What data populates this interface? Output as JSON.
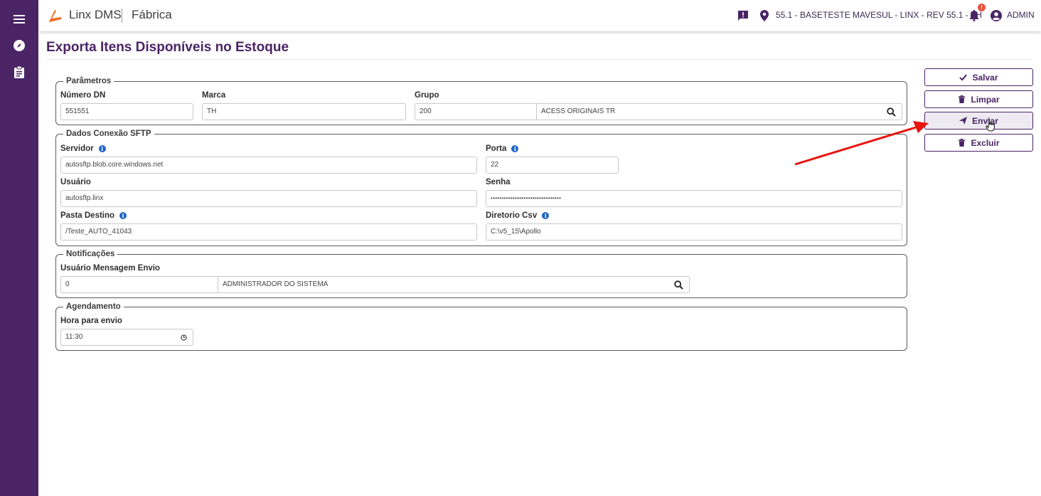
{
  "app": {
    "brand": "Linx DMS",
    "module": "Fábrica"
  },
  "topbar": {
    "location": "55.1 - BASETESTE MAVESUL - LINX - REV 55.1 - TH",
    "notification_badge": "!",
    "user": "ADMIN"
  },
  "page": {
    "title": "Exporta Itens Disponíveis no Estoque"
  },
  "parametros": {
    "legend": "Parâmetros",
    "numero_dn": {
      "label": "Número DN",
      "value": "551551"
    },
    "marca": {
      "label": "Marca",
      "value": "TH"
    },
    "grupo": {
      "label": "Grupo",
      "code": "200",
      "description": "ACESS ORIGINAIS TR"
    }
  },
  "sftp": {
    "legend": "Dados Conexão SFTP",
    "servidor": {
      "label": "Servidor",
      "value": "autosftp.blob.core.windows.net"
    },
    "porta": {
      "label": "Porta",
      "value": "22"
    },
    "usuario": {
      "label": "Usuário",
      "value": "autosftp.linx"
    },
    "senha": {
      "label": "Senha",
      "value": "••••••••••••••••••••••••••••••••"
    },
    "pasta_destino": {
      "label": "Pasta Destino",
      "value": "/Teste_AUTO_41043"
    },
    "diretorio_csv": {
      "label": "Diretorio Csv",
      "value": "C:\\v5_15\\Apollo"
    }
  },
  "notificacoes": {
    "legend": "Notificações",
    "usuario_mensagem": {
      "label": "Usuário Mensagem Envio",
      "code": "0",
      "description": "ADMINISTRADOR DO SISTEMA"
    }
  },
  "agendamento": {
    "legend": "Agendamento",
    "hora": {
      "label": "Hora para envio",
      "value": "11:30"
    }
  },
  "actions": {
    "salvar": "Salvar",
    "limpar": "Limpar",
    "enviar": "Enviar",
    "excluir": "Excluir"
  },
  "colors": {
    "primary": "#4b2466",
    "accent": "#f26a21",
    "annotation_arrow": "#e8140f",
    "info": "#1f64c7"
  }
}
